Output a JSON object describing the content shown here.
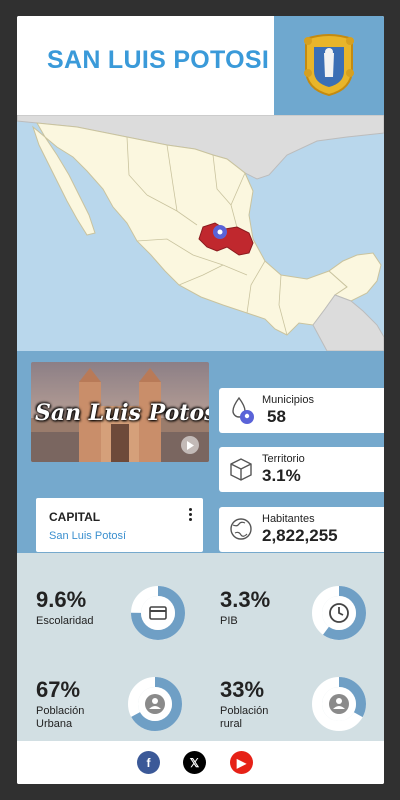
{
  "header": {
    "title": "San Luis Potosi"
  },
  "media": {
    "caption": "San Luis Potosí"
  },
  "capital": {
    "label": "CAPITAL",
    "value": "San Luis Potosí"
  },
  "info": [
    {
      "label": "Municipios",
      "value": "58",
      "icon": "water-drop-icon"
    },
    {
      "label": "Territorio",
      "value": "3.1%",
      "icon": "box-icon"
    },
    {
      "label": "Habitantes",
      "value": "2,822,255",
      "icon": "globe-icon"
    }
  ],
  "kpis": [
    {
      "value": "9.6%",
      "label": "Escolaridad",
      "fraction": 0.75,
      "icon": "credit-card-icon"
    },
    {
      "value": "3.3%",
      "label": "PIB",
      "fraction": 0.6,
      "icon": "clock-icon"
    },
    {
      "value": "67%",
      "label": "Población Urbana",
      "fraction": 0.67,
      "icon": "person-icon"
    },
    {
      "value": "33%",
      "label": "Población rural",
      "fraction": 0.33,
      "icon": "person-icon"
    }
  ],
  "social": [
    {
      "name": "facebook-icon",
      "glyph": "f",
      "color": "#3b5998"
    },
    {
      "name": "x-icon",
      "glyph": "𝕏",
      "color": "#000000"
    },
    {
      "name": "youtube-icon",
      "glyph": "▶",
      "color": "#e62117"
    }
  ],
  "colors": {
    "accent": "#3a9ad9",
    "panel": "#75a9cd",
    "highlight": "#c0282e",
    "donut": "#6f9fc5"
  }
}
